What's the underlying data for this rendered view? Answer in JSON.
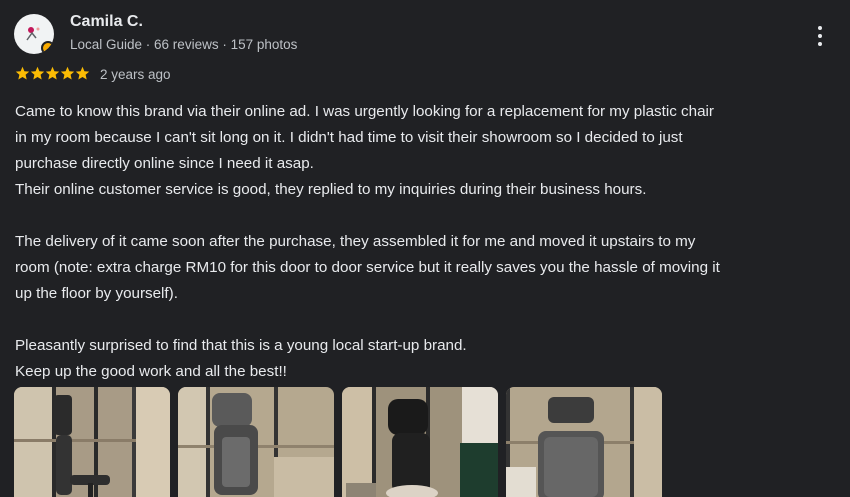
{
  "reviewer": {
    "name": "Camila C.",
    "meta": "Local Guide · 66 reviews · 157 photos",
    "avatar_icon": "profile-avatar"
  },
  "rating": {
    "stars": 5,
    "max": 5,
    "color": "#fbbc04"
  },
  "time": "2 years ago",
  "review_lines": [
    "Came to know this brand via their online ad. I was urgently looking for a replacement for my plastic chair",
    "in my room because I can't sit long on it. I didn't had time to visit their showroom so I decided to just",
    "purchase directly online since I need it asap.",
    "Their online customer service is good, they replied to my inquiries during their business hours.",
    "",
    "The delivery of it came soon after the purchase, they assembled it for me and moved it upstairs to my",
    "room (note: extra charge RM10 for this door to door service but it really saves you the hassle of moving it",
    "up the floor by yourself).",
    "",
    "Pleasantly surprised to find that this is a young local start-up brand.",
    "Keep up the good work and all the best!!"
  ],
  "photos": [
    {
      "subject": "office-chair-photo-1"
    },
    {
      "subject": "office-chair-photo-2"
    },
    {
      "subject": "office-chair-photo-3"
    },
    {
      "subject": "office-chair-photo-4"
    }
  ],
  "colors": {
    "background": "#202124",
    "text": "#e8eaed",
    "secondary": "#bdc1c6"
  }
}
